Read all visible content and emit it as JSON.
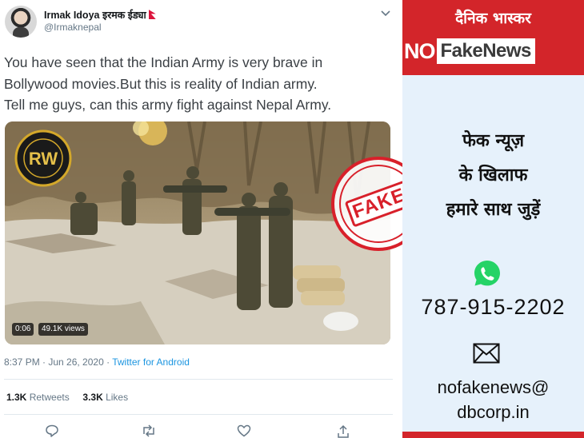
{
  "tweet": {
    "author_name": "Irmak Idoya इरमक ईड्या",
    "handle": "@Irmaknepal",
    "text_lines": [
      "You have seen that the Indian Army is very brave in",
      "Bollywood movies.But this is reality of Indian army.",
      "Tell me guys, can this army fight against Nepal Army."
    ],
    "video": {
      "duration": "0:06",
      "views": "49.1K views",
      "watermark_logo": "RW"
    },
    "timestamp": "8:37 PM · Jun 26, 2020 · ",
    "source": "Twitter for Android",
    "retweets_count": "1.3K",
    "retweets_label": " Retweets",
    "likes_count": "3.3K",
    "likes_label": " Likes",
    "icons": [
      "chevron-down-icon",
      "reply-icon",
      "retweet-icon",
      "like-icon",
      "share-icon",
      "nepal-flag-icon"
    ]
  },
  "stamp": {
    "label": "FAKE",
    "color": "#d8202a"
  },
  "sidebar": {
    "brand_hindi": "दैनिक भास्कर",
    "brand_no": "NO",
    "brand_fakenews": "FakeNews",
    "slogan_lines": [
      "फेक न्यूज़",
      "के खिलाफ",
      "हमारे साथ जुड़ें"
    ],
    "phone": "787-915-2202",
    "email_lines": [
      "nofakenews@",
      "dbcorp.in"
    ],
    "icons": [
      "whatsapp-icon",
      "envelope-icon"
    ]
  },
  "colors": {
    "brand_red": "#d3252a",
    "panel_bg": "#e6f1fb",
    "whatsapp_green": "#25d366",
    "link_blue": "#1b95e0",
    "muted_text": "#657786"
  }
}
